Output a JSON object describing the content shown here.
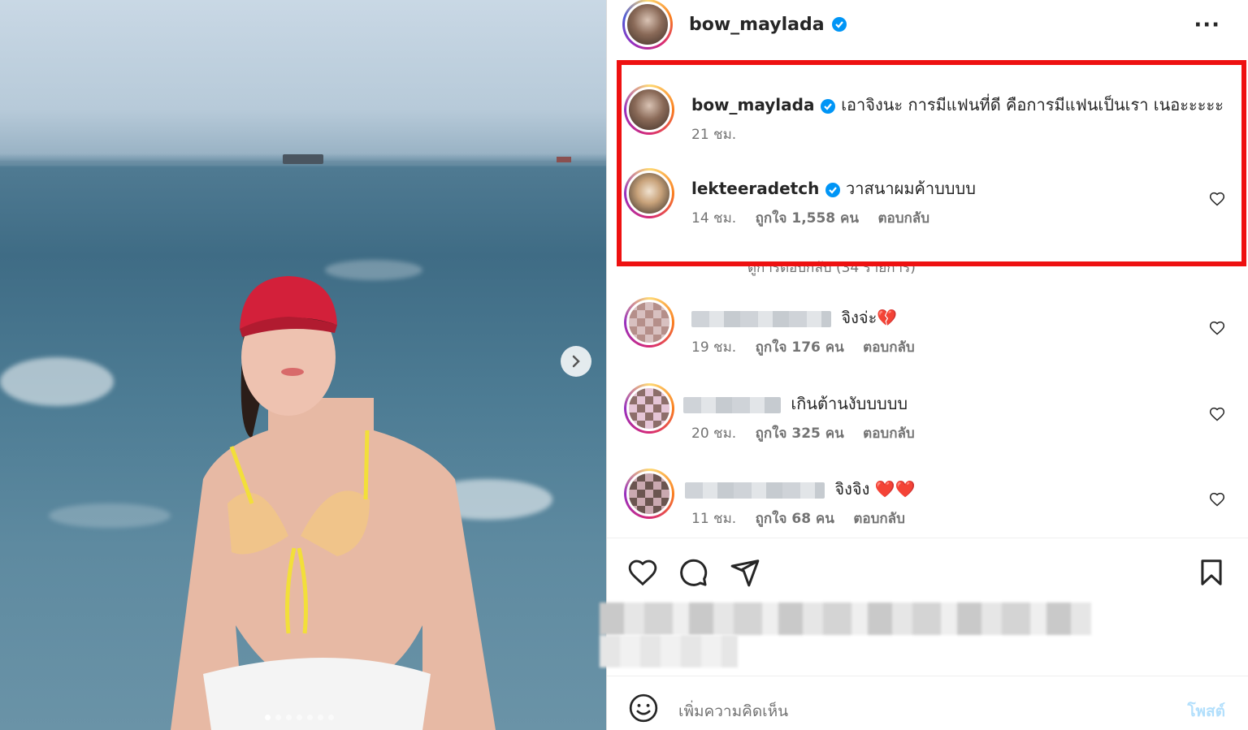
{
  "post": {
    "author": "bow_maylada",
    "more_label": "···"
  },
  "comments": [
    {
      "username": "bow_maylada",
      "text": "เอาจิงนะ การมีแฟนที่ดี คือการมีแฟนเป็นเรา เนอะะะะะ",
      "time": "21 ชม."
    },
    {
      "username": "lekteeradetch",
      "text": "วาสนาผมค้าบบบบ",
      "time": "14 ชม.",
      "likes": "ถูกใจ 1,558 คน",
      "reply": "ตอบกลับ"
    },
    {
      "username": "",
      "text": "จิงจ่ะ💔",
      "time": "19 ชม.",
      "likes": "ถูกใจ 176 คน",
      "reply": "ตอบกลับ"
    },
    {
      "username": "",
      "text": "เกินต้านงับบบบบ",
      "time": "20 ชม.",
      "likes": "ถูกใจ 325 คน",
      "reply": "ตอบกลับ"
    },
    {
      "username": "",
      "text": "จิงจิง ❤️❤️",
      "time": "11 ชม.",
      "likes": "ถูกใจ 68 คน",
      "reply": "ตอบกลับ"
    }
  ],
  "view_replies": "ดูการตอบกลับ (34 รายการ)",
  "composer": {
    "placeholder": "เพิ่มความคิดเห็น",
    "post_label": "โพสต์"
  },
  "colors": {
    "highlight": "#ee1111",
    "verified": "#0095f6",
    "post_disabled": "#b2dffc"
  },
  "photo": {
    "carousel_count": 7,
    "active_index": 0
  }
}
